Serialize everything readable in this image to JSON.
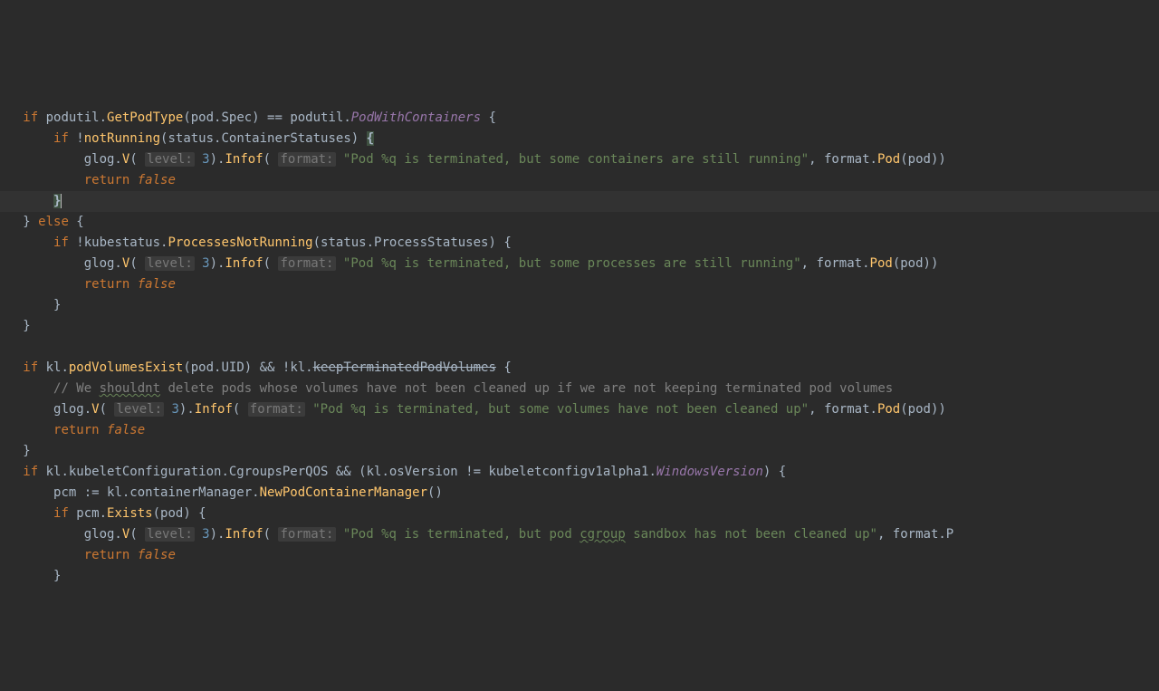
{
  "lines": {
    "l1_if": "if",
    "l1_a": " podutil.",
    "l1_fn1": "GetPodType",
    "l1_b": "(pod.Spec) == podutil.",
    "l1_const": "PodWithContainers",
    "l1_c": " {",
    "l2_if": "if",
    "l2_a": " !",
    "l2_fn": "notRunning",
    "l2_b": "(status.ContainerStatuses) ",
    "l2_brace": "{",
    "l3_a": "glog.",
    "l3_fn1": "V",
    "l3_b": "( ",
    "l3_hint1": "level:",
    "l3_num": " 3",
    "l3_c": ").",
    "l3_fn2": "Infof",
    "l3_d": "( ",
    "l3_hint2": "format:",
    "l3_str": " \"Pod %q is terminated, but some containers are still running\"",
    "l3_e": ", format.",
    "l3_fn3": "Pod",
    "l3_f": "(pod))",
    "l4_kw": "return",
    "l4_val": " false",
    "l5_brace": "}",
    "l6_a": "} ",
    "l6_kw": "else",
    "l6_b": " {",
    "l7_if": "if",
    "l7_a": " !kubestatus.",
    "l7_fn": "ProcessesNotRunning",
    "l7_b": "(status.ProcessStatuses) {",
    "l8_a": "glog.",
    "l8_fn1": "V",
    "l8_b": "( ",
    "l8_hint1": "level:",
    "l8_num": " 3",
    "l8_c": ").",
    "l8_fn2": "Infof",
    "l8_d": "( ",
    "l8_hint2": "format:",
    "l8_str": " \"Pod %q is terminated, but some processes are still running\"",
    "l8_e": ", format.",
    "l8_fn3": "Pod",
    "l8_f": "(pod))",
    "l9_kw": "return",
    "l9_val": " false",
    "l10": "}",
    "l11": "}",
    "l13_if": "if",
    "l13_a": " kl.",
    "l13_fn1": "podVolumesExist",
    "l13_b": "(pod.UID) && !kl.",
    "l13_dep": "keepTerminatedPodVolumes",
    "l13_c": " {",
    "l14_a": "// We ",
    "l14_typo": "shouldnt",
    "l14_b": " delete pods whose volumes have not been cleaned up if we are not keeping terminated pod volumes",
    "l15_a": "glog.",
    "l15_fn1": "V",
    "l15_b": "( ",
    "l15_hint1": "level:",
    "l15_num": " 3",
    "l15_c": ").",
    "l15_fn2": "Infof",
    "l15_d": "( ",
    "l15_hint2": "format:",
    "l15_str": " \"Pod %q is terminated, but some volumes have not been cleaned up\"",
    "l15_e": ", format.",
    "l15_fn3": "Pod",
    "l15_f": "(pod))",
    "l16_kw": "return",
    "l16_val": " false",
    "l17": "}",
    "l18_if": "if",
    "l18_a": " kl.kubeletConfiguration.CgroupsPerQOS && (kl.osVersion != kubeletconfigv1alpha1.",
    "l18_const": "WindowsVersion",
    "l18_b": ") {",
    "l19_a": "pcm := kl.containerManager.",
    "l19_fn": "NewPodContainerManager",
    "l19_b": "()",
    "l20_if": "if",
    "l20_a": " pcm.",
    "l20_fn": "Exists",
    "l20_b": "(pod) {",
    "l21_a": "glog.",
    "l21_fn1": "V",
    "l21_b": "( ",
    "l21_hint1": "level:",
    "l21_num": " 3",
    "l21_c": ").",
    "l21_fn2": "Infof",
    "l21_d": "( ",
    "l21_hint2": "format:",
    "l21_str": " \"Pod %q is terminated, but pod ",
    "l21_typo": "cgroup",
    "l21_str2": " sandbox has not been cleaned up\"",
    "l21_e": ", format.P",
    "l22_kw": "return",
    "l22_val": " false",
    "l23": "}"
  }
}
